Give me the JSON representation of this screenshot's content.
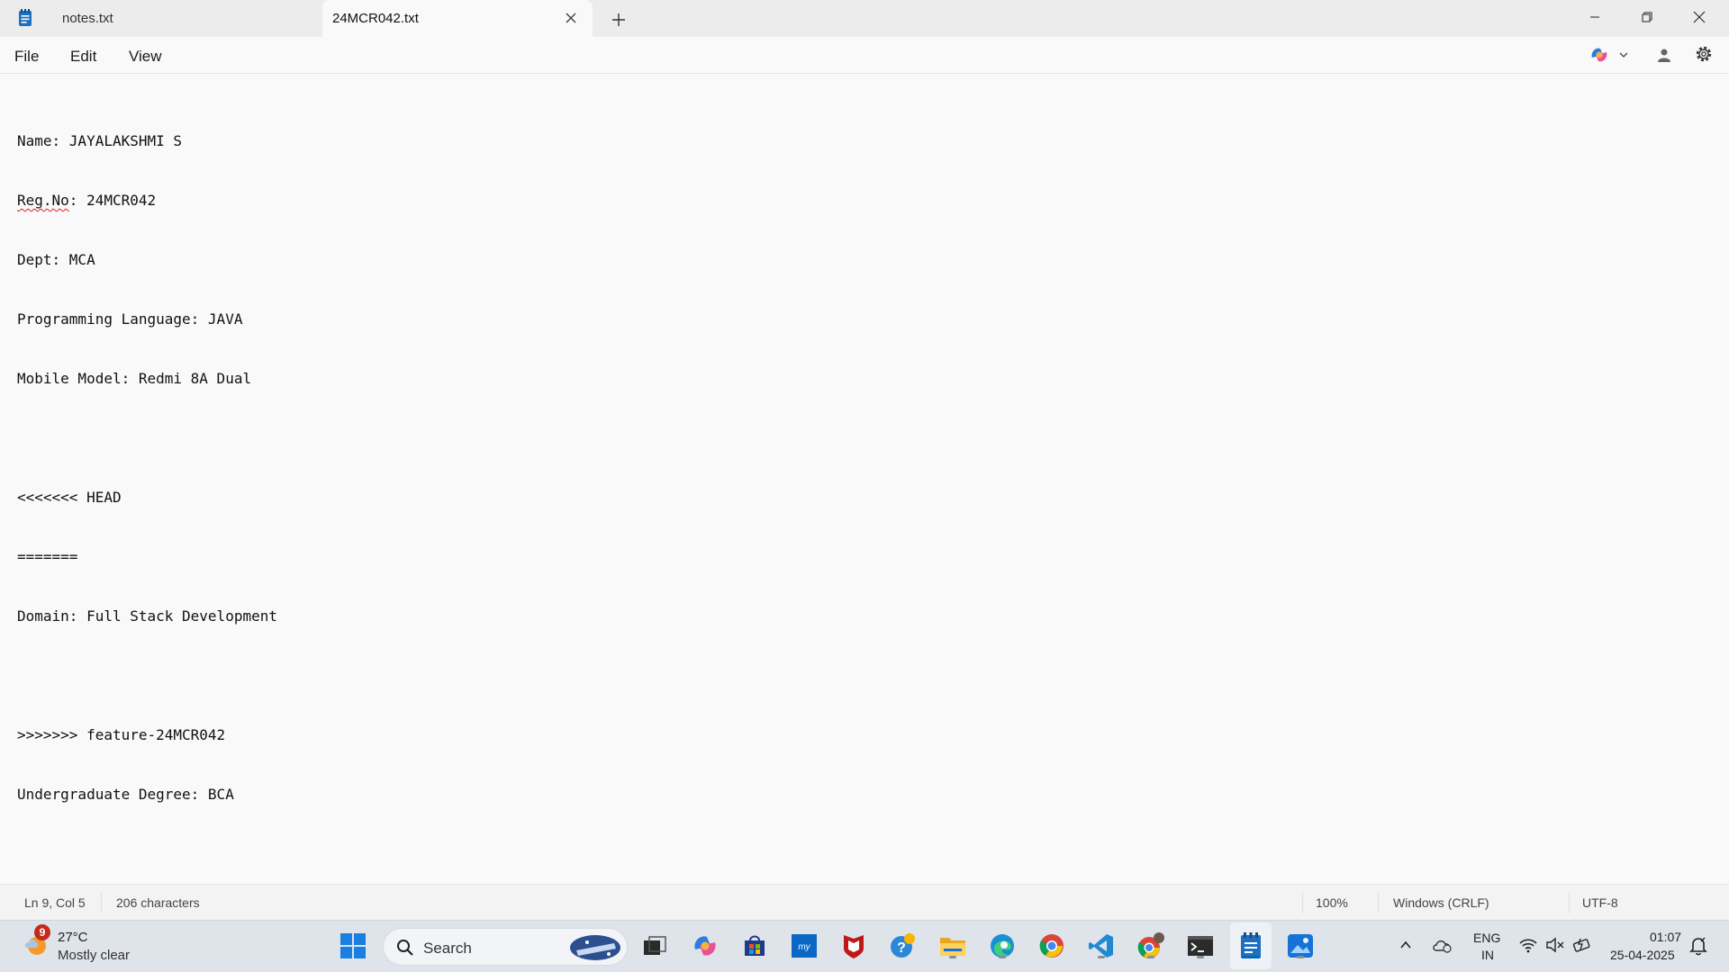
{
  "tabs": [
    {
      "label": "notes.txt"
    },
    {
      "label": "24MCR042.txt"
    }
  ],
  "menu": {
    "file": "File",
    "edit": "Edit",
    "view": "View"
  },
  "editor": {
    "lines": [
      "Name: JAYALAKSHMI S",
      "Reg.No",
      ": 24MCR042",
      "Dept: MCA",
      "Programming Language: JAVA",
      "Mobile Model: Redmi 8A Dual",
      "",
      "<<<<<<< HEAD",
      "=======",
      "Domain: Full Stack Development",
      "",
      ">>>>>>> feature-24MCR042",
      "Undergraduate Degree: BCA"
    ]
  },
  "status": {
    "position": "Ln 9, Col 5",
    "characters": "206 characters",
    "zoom": "100%",
    "line_ending": "Windows (CRLF)",
    "encoding": "UTF-8"
  },
  "taskbar": {
    "weather_badge": "9",
    "weather_temp": "27°C",
    "weather_desc": "Mostly clear",
    "search_label": "Search",
    "lang_line1": "ENG",
    "lang_line2": "IN",
    "time": "01:07",
    "date": "25-04-2025"
  },
  "icons": [
    "notepad-icon",
    "close-icon",
    "plus-icon",
    "minimize-icon",
    "maximize-icon",
    "copilot-icon",
    "account-icon",
    "settings-icon",
    "windows-start-icon",
    "search-icon",
    "task-view-icon",
    "copilot-app-icon",
    "store-icon",
    "myhp-icon",
    "mcafee-icon",
    "help-icon",
    "file-explorer-icon",
    "edge-icon",
    "chrome-icon",
    "vscode-icon",
    "chrome-profile-icon",
    "terminal-icon",
    "notepad-app-icon",
    "photos-icon",
    "chevron-up-icon",
    "onedrive-icon",
    "wifi-icon",
    "volume-muted-icon",
    "battery-icon",
    "notification-bell-icon"
  ],
  "colors": {
    "accent": "#0067c0",
    "titlebar": "#ececec",
    "editor_bg": "#f9f9f9",
    "taskbar": "#dfe4ea"
  }
}
